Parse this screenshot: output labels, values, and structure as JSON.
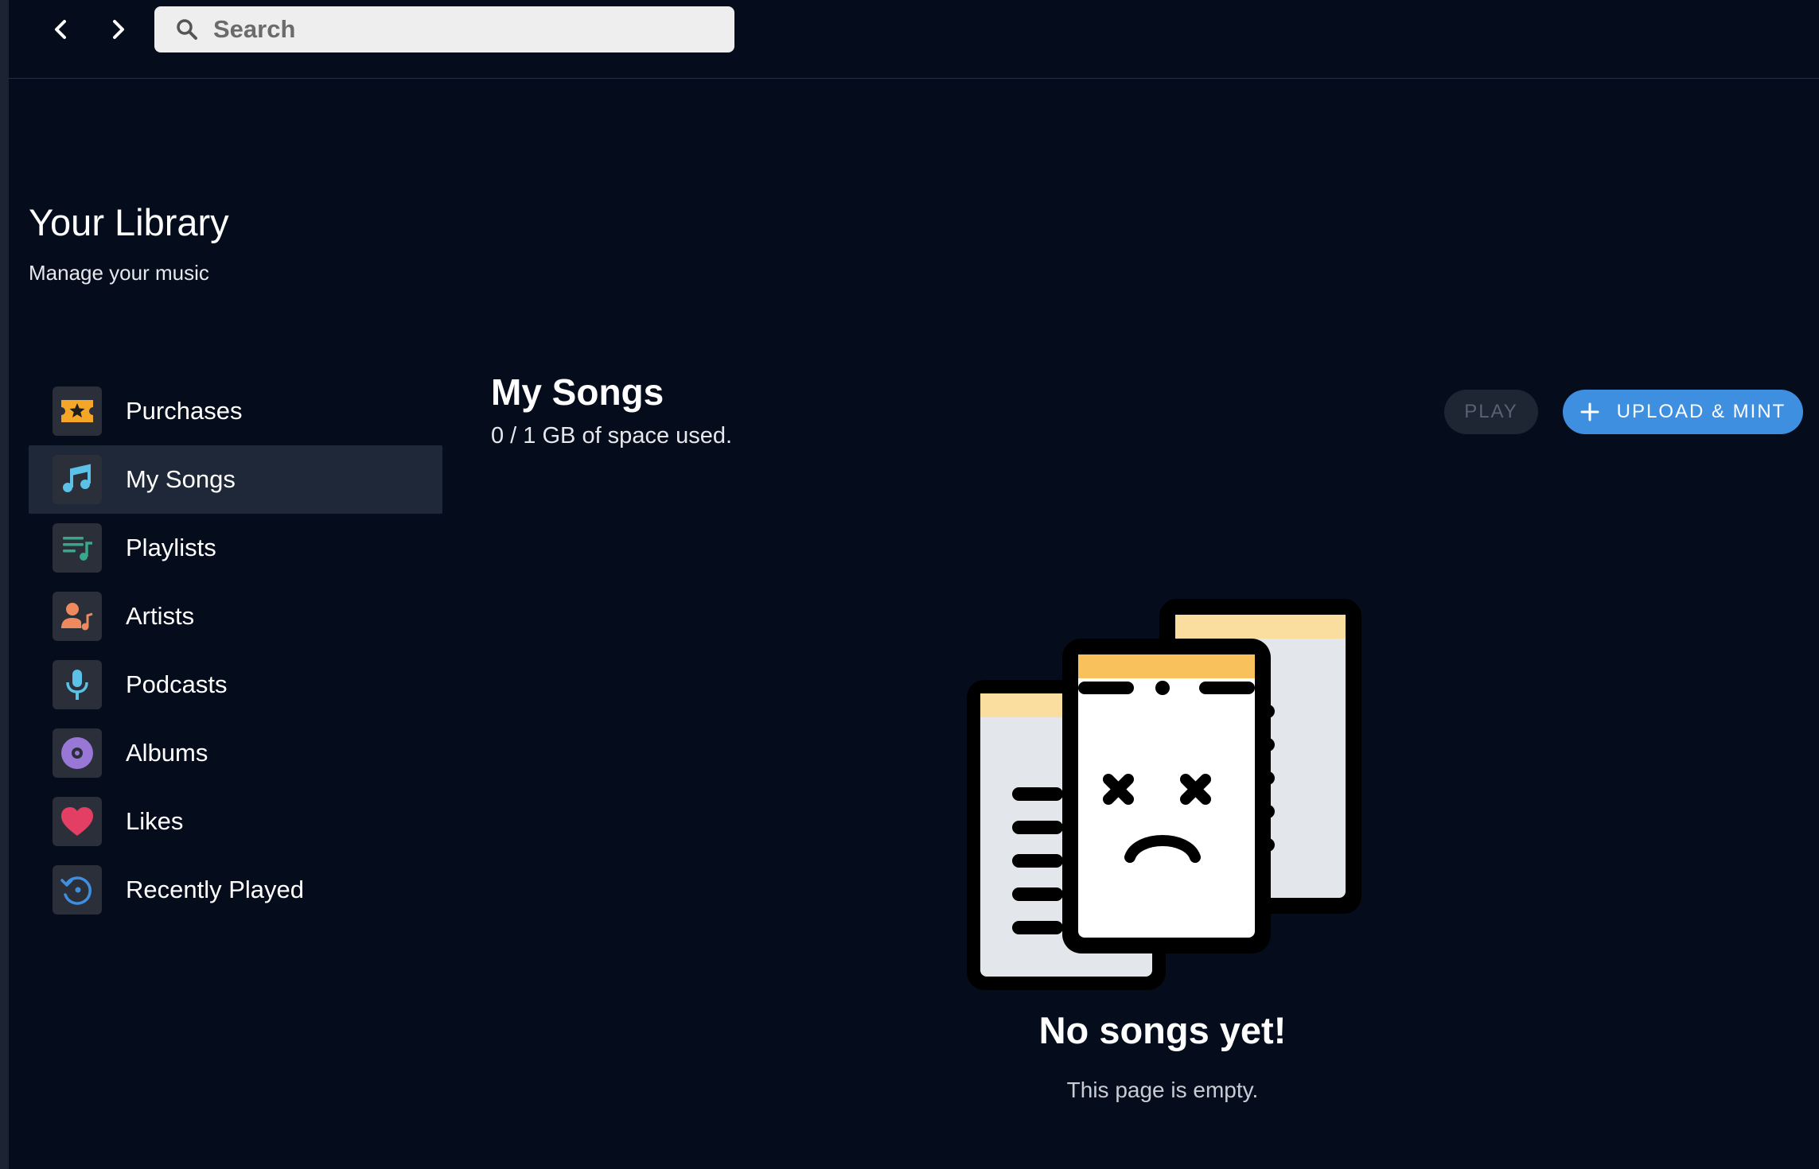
{
  "search": {
    "placeholder": "Search"
  },
  "library": {
    "title": "Your Library",
    "subtitle": "Manage your music"
  },
  "sidebar": {
    "items": [
      {
        "label": "Purchases",
        "icon": "ticket-star-icon",
        "active": false
      },
      {
        "label": "My Songs",
        "icon": "music-note-icon",
        "active": true
      },
      {
        "label": "Playlists",
        "icon": "playlist-icon",
        "active": false
      },
      {
        "label": "Artists",
        "icon": "artist-icon",
        "active": false
      },
      {
        "label": "Podcasts",
        "icon": "microphone-icon",
        "active": false
      },
      {
        "label": "Albums",
        "icon": "vinyl-icon",
        "active": false
      },
      {
        "label": "Likes",
        "icon": "heart-icon",
        "active": false
      },
      {
        "label": "Recently Played",
        "icon": "history-icon",
        "active": false
      }
    ]
  },
  "main": {
    "title": "My Songs",
    "storage": "0 / 1 GB of space used.",
    "play_label": "PLAY",
    "upload_label": "UPLOAD & MINT",
    "empty_title": "No songs yet!",
    "empty_subtitle": "This page is empty."
  },
  "colors": {
    "background": "#050d1d",
    "accent": "#3e8fe0",
    "active_item": "#1f2838"
  }
}
